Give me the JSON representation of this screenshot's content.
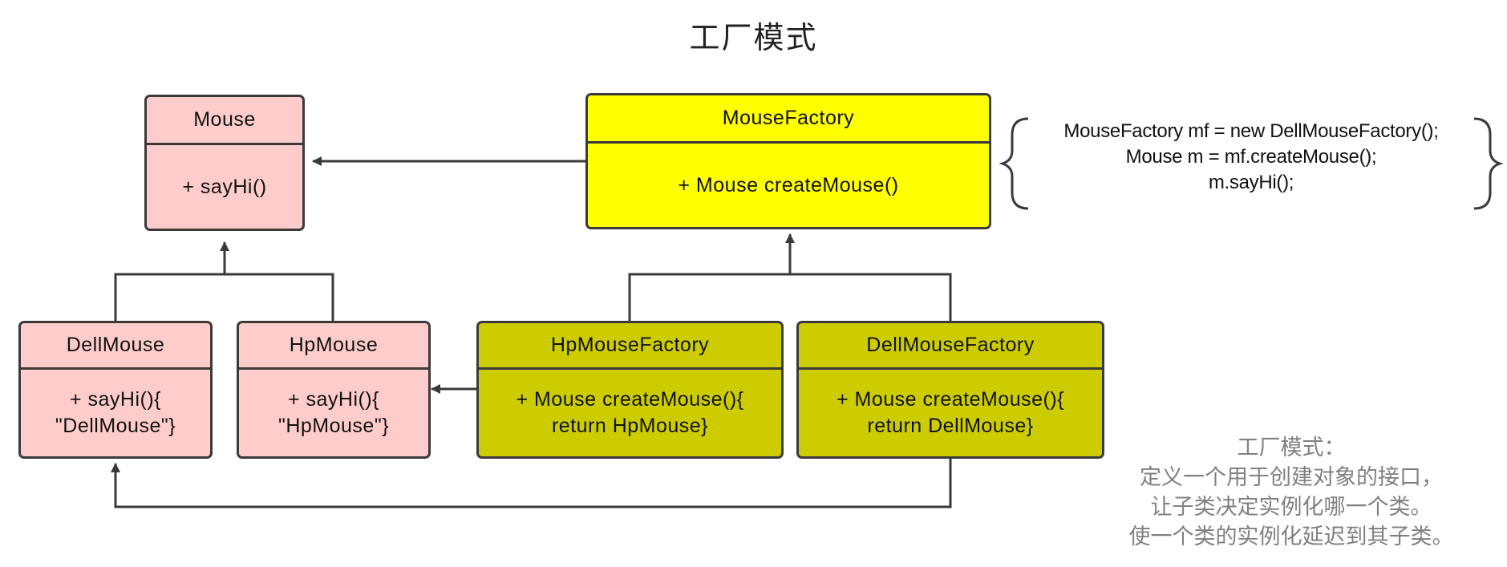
{
  "title": "工厂模式",
  "classes": {
    "mouse": {
      "name": "Mouse",
      "body": "+ sayHi()"
    },
    "dell_mouse": {
      "name": "DellMouse",
      "body_lines": [
        "+ sayHi(){",
        "\"DellMouse\"}"
      ]
    },
    "hp_mouse": {
      "name": "HpMouse",
      "body_lines": [
        "+ sayHi(){",
        "\"HpMouse\"}"
      ]
    },
    "mouse_factory": {
      "name": "MouseFactory",
      "body": "+ Mouse createMouse()"
    },
    "hp_mouse_factory": {
      "name": "HpMouseFactory",
      "body_lines": [
        "+ Mouse createMouse(){",
        "return HpMouse}"
      ]
    },
    "dell_mouse_factory": {
      "name": "DellMouseFactory",
      "body_lines": [
        "+ Mouse createMouse(){",
        "return DellMouse}"
      ]
    }
  },
  "code_note": [
    "MouseFactory mf = new DellMouseFactory();",
    "Mouse m = mf.createMouse();",
    "m.sayHi();"
  ],
  "description": [
    "工厂模式：",
    "定义一个用于创建对象的接口，",
    "让子类决定实例化哪一个类。",
    "使一个类的实例化延迟到其子类。"
  ],
  "colors": {
    "product": "#ffcccc",
    "creator": "#ffff00",
    "concrete_creator": "#cccc00",
    "line": "#3a3a3a"
  }
}
